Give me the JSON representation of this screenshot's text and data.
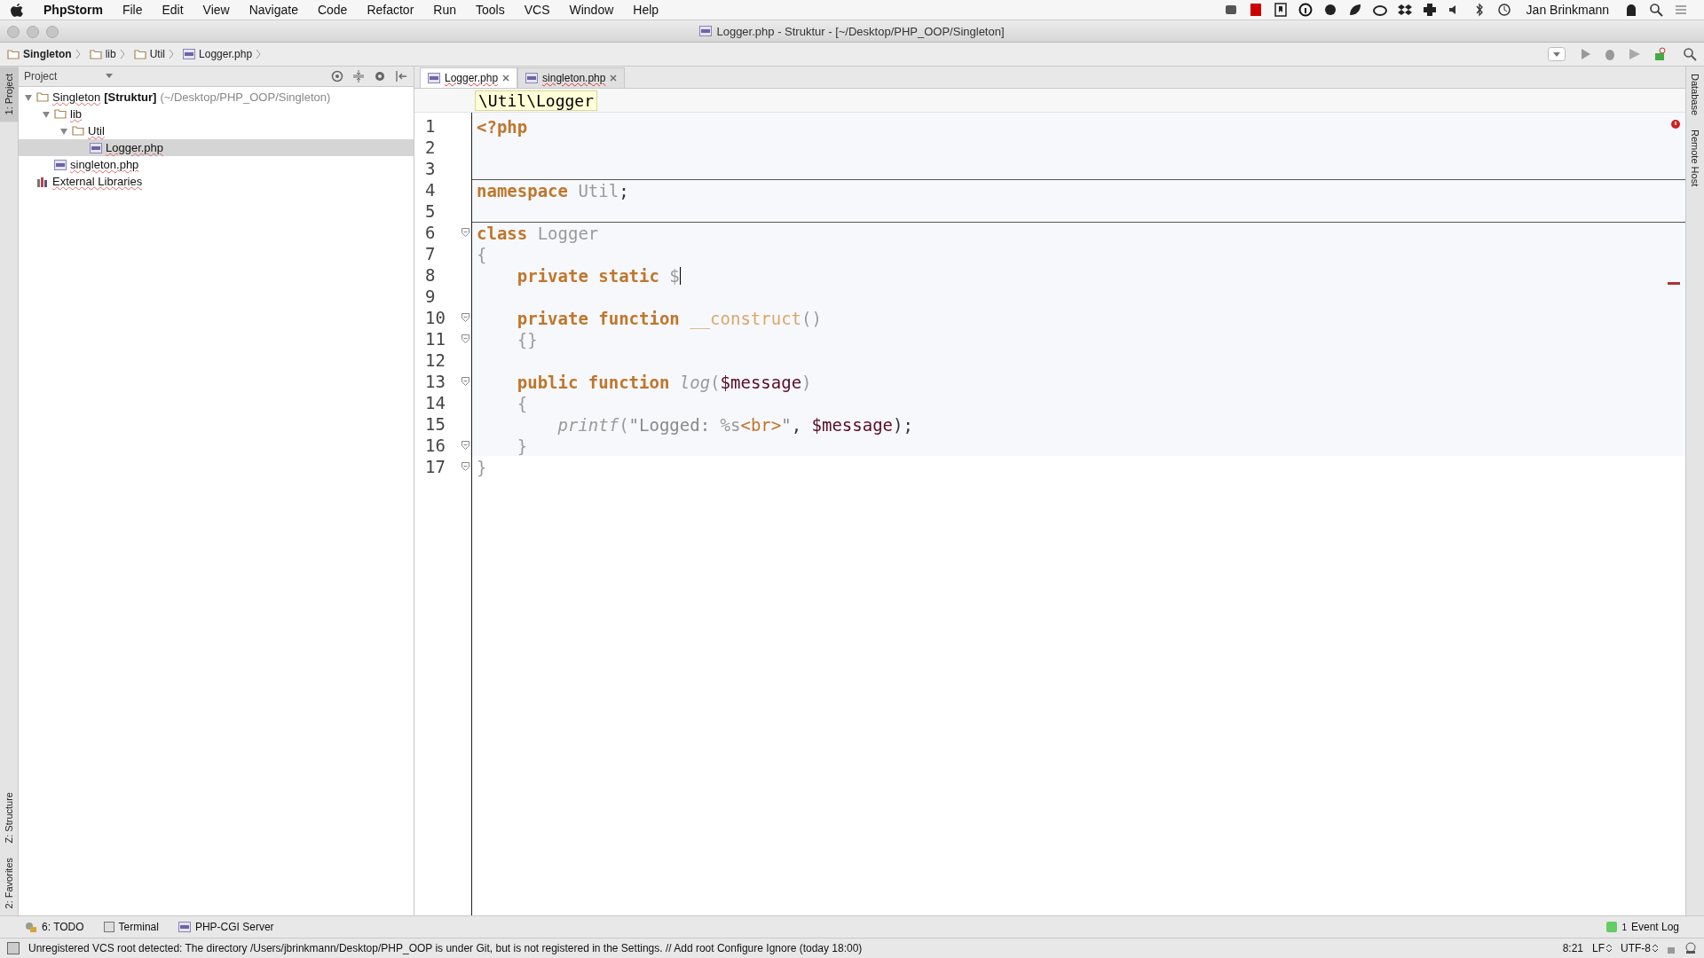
{
  "menu_bar": {
    "app": "PhpStorm",
    "items": [
      "File",
      "Edit",
      "View",
      "Navigate",
      "Code",
      "Refactor",
      "Run",
      "Tools",
      "VCS",
      "Window",
      "Help"
    ],
    "user": "Jan Brinkmann"
  },
  "window": {
    "title": "Logger.php - Struktur - [~/Desktop/PHP_OOP/Singleton]"
  },
  "breadcrumbs": [
    {
      "label": "Singleton",
      "kind": "folder",
      "bold": true
    },
    {
      "label": "lib",
      "kind": "folder",
      "bold": false
    },
    {
      "label": "Util",
      "kind": "folder",
      "bold": false
    },
    {
      "label": "Logger.php",
      "kind": "php",
      "bold": false
    }
  ],
  "left_strip": [
    {
      "label": "1: Project",
      "selected": true
    },
    {
      "label": "Z: Structure",
      "selected": false
    },
    {
      "label": "2: Favorites",
      "selected": false
    }
  ],
  "right_strip": [
    "Database",
    "Remote Host"
  ],
  "project_panel": {
    "title": "Project",
    "tree": [
      {
        "label": "Singleton",
        "bold_suffix": "[Struktur]",
        "path": "(~/Desktop/PHP_OOP/Singleton)",
        "kind": "folder",
        "expanded": true,
        "selected": false,
        "children": [
          {
            "label": "lib",
            "kind": "folder",
            "expanded": true,
            "selected": false,
            "children": [
              {
                "label": "Util",
                "kind": "folder",
                "expanded": true,
                "selected": false,
                "children": [
                  {
                    "label": "Logger.php",
                    "kind": "php",
                    "selected": true
                  }
                ]
              }
            ]
          },
          {
            "label": "singleton.php",
            "kind": "php",
            "selected": false
          }
        ]
      },
      {
        "label": "External Libraries",
        "kind": "library",
        "selected": false
      }
    ]
  },
  "editor": {
    "tabs": [
      {
        "label": "Logger.php",
        "selected": true
      },
      {
        "label": "singleton.php",
        "selected": false
      }
    ],
    "namespace_hint": "\\Util\\Logger",
    "lines": [
      {
        "number": "1",
        "kind": "top",
        "tokens": [
          {
            "kind": "keyword",
            "text": "<?php"
          }
        ]
      },
      {
        "number": "2",
        "kind": "top"
      },
      {
        "number": "3",
        "kind": "top"
      },
      {
        "number": "4",
        "kind": "top",
        "separator": true,
        "tokens": [
          {
            "kind": "keyword",
            "text": "namespace"
          },
          {
            "kind": "name",
            "text": "Util",
            "space": true
          },
          {
            "kind": "punct",
            "text": ";"
          }
        ]
      },
      {
        "number": "5",
        "kind": "top"
      },
      {
        "number": "6",
        "kind": "top",
        "fold": true,
        "separator": true,
        "tokens": [
          {
            "kind": "keyword",
            "text": "class"
          },
          {
            "kind": "name",
            "text": "Logger",
            "space": true
          }
        ]
      },
      {
        "number": "7",
        "kind": "top",
        "tokens": [
          {
            "kind": "name",
            "text": "{"
          }
        ]
      },
      {
        "number": "8",
        "kind": "member",
        "caret": true,
        "tokens": [
          {
            "kind": "keyword",
            "text": "private static"
          },
          {
            "kind": "name",
            "text": "$",
            "space": true
          }
        ]
      },
      {
        "number": "9",
        "kind": "top"
      },
      {
        "number": "10",
        "kind": "member",
        "fold": true,
        "tokens": [
          {
            "kind": "keyword",
            "text": "private function"
          },
          {
            "kind": "method",
            "text": "__construct",
            "space": true
          },
          {
            "kind": "name",
            "text": "()"
          }
        ]
      },
      {
        "number": "11",
        "kind": "member",
        "fold": true,
        "tokens": [
          {
            "kind": "name",
            "text": "{}"
          }
        ]
      },
      {
        "number": "12",
        "kind": "top"
      },
      {
        "number": "13",
        "kind": "member",
        "fold": true,
        "tokens": [
          {
            "kind": "keyword",
            "text": "public function"
          },
          {
            "kind": "call",
            "text": "log",
            "space": true
          },
          {
            "kind": "name",
            "text": "("
          },
          {
            "kind": "variable",
            "text": "$message"
          },
          {
            "kind": "name",
            "text": ")"
          }
        ]
      },
      {
        "number": "14",
        "kind": "member",
        "tokens": [
          {
            "kind": "name",
            "text": "{"
          }
        ]
      },
      {
        "number": "15",
        "kind": "statement",
        "tokens": [
          {
            "kind": "call",
            "text": "printf"
          },
          {
            "kind": "name",
            "text": "("
          },
          {
            "kind": "string",
            "text": "\"Logged:"
          },
          {
            "kind": "name",
            "text": "%s",
            "space": true
          },
          {
            "kind": "keyword_light",
            "text": "<br>"
          },
          {
            "kind": "string",
            "text": "\""
          },
          {
            "kind": "punct",
            "text": ","
          },
          {
            "kind": "variable",
            "text": "$message",
            "space": true
          },
          {
            "kind": "punct",
            "text": ");"
          }
        ]
      },
      {
        "number": "16",
        "kind": "member",
        "fold": true,
        "tokens": [
          {
            "kind": "name",
            "text": "}"
          }
        ]
      },
      {
        "number": "17",
        "kind": "top",
        "fold": true,
        "tokens": [
          {
            "kind": "name",
            "text": "}"
          }
        ]
      }
    ]
  },
  "bottom_tabs": [
    {
      "label": "6: TODO",
      "kind": "todo"
    },
    {
      "label": "Terminal",
      "kind": "terminal"
    },
    {
      "label": "PHP-CGI Server",
      "kind": "php"
    }
  ],
  "event_log": {
    "label": "Event Log",
    "count": "1"
  },
  "status_bar": {
    "message": "Unregistered VCS root detected: The directory /Users/jbrinkmann/Desktop/PHP_OOP is under Git, but is not registered in the Settings. // Add root  Configure  Ignore (today 18:00)",
    "position": "8:21",
    "line_separator": "LF",
    "encoding": "UTF-8"
  }
}
